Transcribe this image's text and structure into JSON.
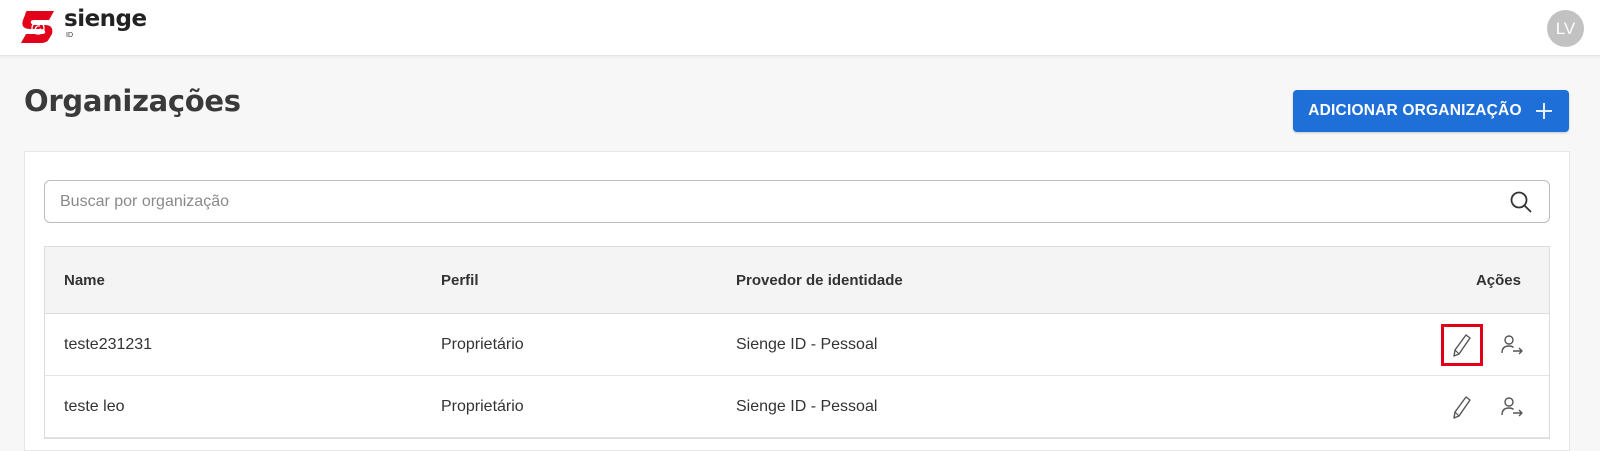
{
  "header": {
    "logo_name": "sienge",
    "logo_sub": "ID",
    "avatar_initials": "LV",
    "brand_color": "#e3001b"
  },
  "page": {
    "title": "Organizações",
    "add_button_label": "ADICIONAR ORGANIZAÇÃO",
    "accent_color": "#1f6fd8"
  },
  "search": {
    "placeholder": "Buscar por organização",
    "value": "",
    "icon": "search-icon"
  },
  "table": {
    "columns": [
      "Name",
      "Perfil",
      "Provedor de identidade",
      "Ações"
    ],
    "rows": [
      {
        "name": "teste231231",
        "perfil": "Proprietário",
        "provedor": "Sienge ID - Pessoal",
        "edit_highlighted": true
      },
      {
        "name": "teste leo",
        "perfil": "Proprietário",
        "provedor": "Sienge ID - Pessoal",
        "edit_highlighted": false
      }
    ],
    "action_icons": [
      "pencil-icon",
      "user-transfer-icon"
    ]
  }
}
